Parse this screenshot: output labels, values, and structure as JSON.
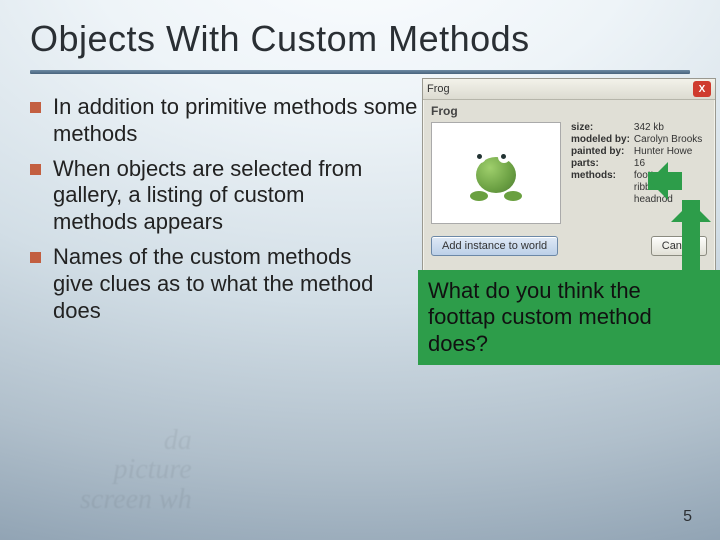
{
  "title": "Objects With Custom Methods",
  "bullets": [
    "In addition to primitive methods some objects have custom methods",
    "When objects are selected from gallery, a listing of custom methods appears",
    "Names of the custom methods give clues as to what the method does"
  ],
  "panel": {
    "window_title": "Frog",
    "object_name": "Frog",
    "meta": {
      "size_label": "size:",
      "size": "342 kb",
      "modeled_label": "modeled by:",
      "modeled": "Carolyn Brooks",
      "painted_label": "painted by:",
      "painted": "Hunter Howe",
      "parts_label": "parts:",
      "parts": "16",
      "methods_label": "methods:",
      "methods": [
        "foottap",
        "ribbit",
        "headnod"
      ]
    },
    "btn_add": "Add instance to world",
    "btn_cancel": "Cancel"
  },
  "callout": "What do you think the foottap custom method does?",
  "page_number": "5",
  "ghost_words": [
    "da",
    "picture",
    "screen wh"
  ]
}
